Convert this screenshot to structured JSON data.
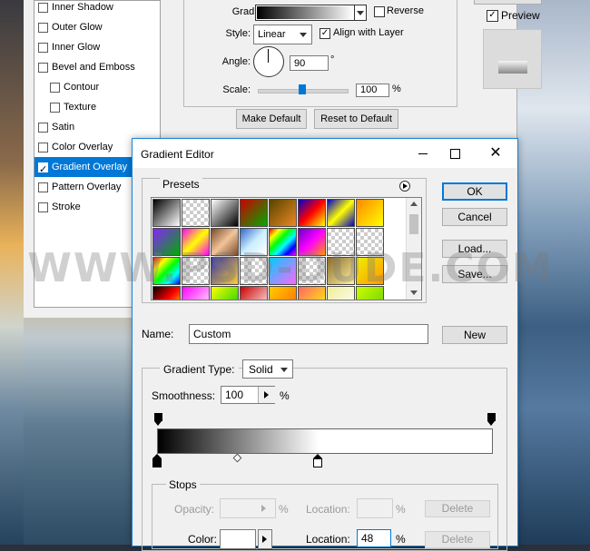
{
  "layer_style": {
    "styles": [
      {
        "label": "Inner Shadow",
        "checked": false,
        "selected": false,
        "indent": false
      },
      {
        "label": "Outer Glow",
        "checked": false,
        "selected": false,
        "indent": false
      },
      {
        "label": "Inner Glow",
        "checked": false,
        "selected": false,
        "indent": false
      },
      {
        "label": "Bevel and Emboss",
        "checked": false,
        "selected": false,
        "indent": false
      },
      {
        "label": "Contour",
        "checked": false,
        "selected": false,
        "indent": true
      },
      {
        "label": "Texture",
        "checked": false,
        "selected": false,
        "indent": true
      },
      {
        "label": "Satin",
        "checked": false,
        "selected": false,
        "indent": false
      },
      {
        "label": "Color Overlay",
        "checked": false,
        "selected": false,
        "indent": false
      },
      {
        "label": "Gradient Overlay",
        "checked": true,
        "selected": true,
        "indent": false
      },
      {
        "label": "Pattern Overlay",
        "checked": false,
        "selected": false,
        "indent": false
      },
      {
        "label": "Stroke",
        "checked": false,
        "selected": false,
        "indent": false
      }
    ],
    "gradient_label": "Gradient:",
    "reverse_label": "Reverse",
    "reverse_checked": false,
    "style_label": "Style:",
    "style_value": "Linear",
    "align_label": "Align with Layer",
    "align_checked": true,
    "angle_label": "Angle:",
    "angle_value": "90",
    "angle_unit": "°",
    "scale_label": "Scale:",
    "scale_value": "100",
    "scale_unit": "%",
    "scale_slider_level": 0.5,
    "make_default": "Make Default",
    "reset_default": "Reset to Default",
    "preview_label": "Preview",
    "preview_checked": true
  },
  "gradient_editor": {
    "title": "Gradient Editor",
    "presets_label": "Presets",
    "ok": "OK",
    "cancel": "Cancel",
    "load": "Load...",
    "save": "Save...",
    "name_label": "Name:",
    "name_value": "Custom",
    "new_button": "New",
    "gradient_type_label": "Gradient Type:",
    "gradient_type_value": "Solid",
    "smoothness_label": "Smoothness:",
    "smoothness_value": "100",
    "smoothness_unit": "%",
    "stops_label": "Stops",
    "opacity_label": "Opacity:",
    "opacity_unit": "%",
    "opacity_location_label": "Location:",
    "opacity_location_unit": "%",
    "delete_label": "Delete",
    "color_label": "Color:",
    "color_location_label": "Location:",
    "color_location_value": "48",
    "color_location_unit": "%",
    "color_stop_positions_pct": [
      0,
      48
    ]
  },
  "watermark": "WWW.PSD-DUDE.COM",
  "colors": {
    "selection": "#0078d7",
    "dialog_border": "#1883d7"
  }
}
